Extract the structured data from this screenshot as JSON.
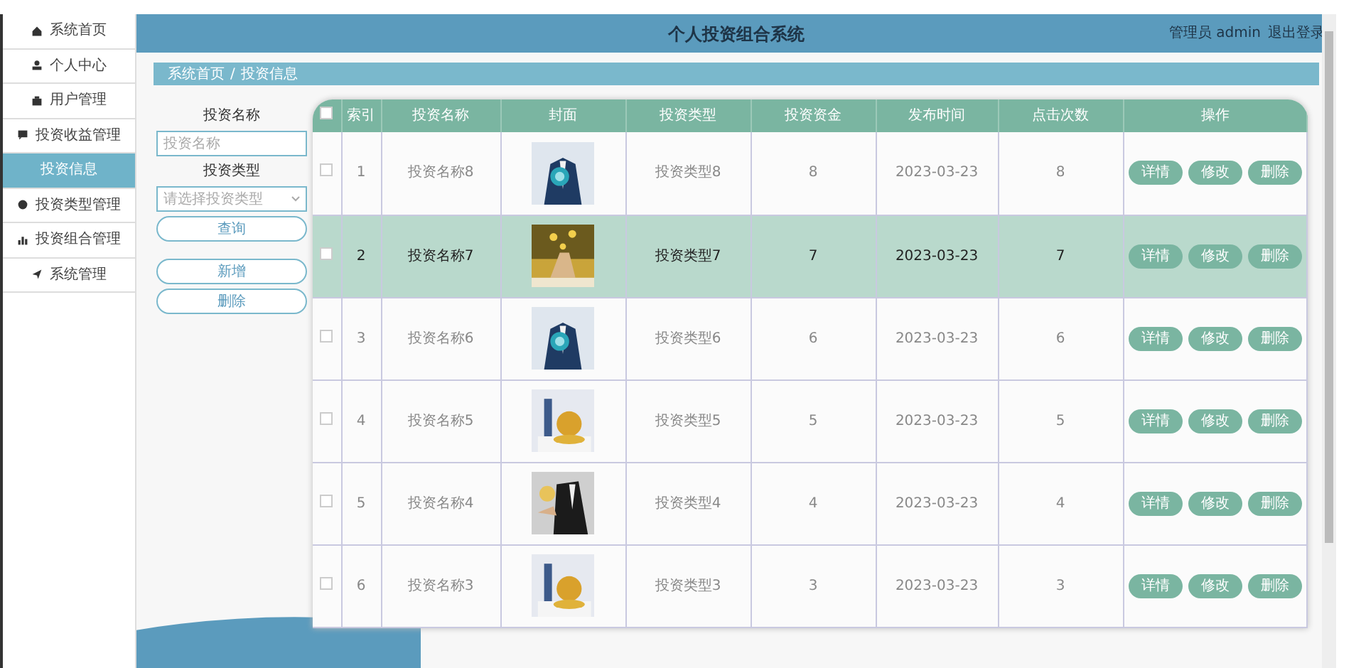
{
  "sidebar": {
    "items": [
      {
        "label": "系统首页",
        "selected": false
      },
      {
        "label": "个人中心",
        "selected": false
      },
      {
        "label": "用户管理",
        "selected": false
      },
      {
        "label": "投资收益管理",
        "selected": false
      },
      {
        "label": "投资信息",
        "selected": true
      },
      {
        "label": "投资类型管理",
        "selected": false
      },
      {
        "label": "投资组合管理",
        "selected": false
      },
      {
        "label": "系统管理",
        "selected": false
      }
    ]
  },
  "header": {
    "title": "个人投资组合系统",
    "user": "管理员 admin",
    "logout": "退出登录"
  },
  "breadcrumb": {
    "home": "系统首页",
    "separator": "/",
    "current": "投资信息"
  },
  "search": {
    "name_label": "投资名称",
    "name_placeholder": "投资名称",
    "type_label": "投资类型",
    "type_placeholder": "请选择投资类型",
    "query": "查询",
    "add": "新增",
    "delete": "删除"
  },
  "table": {
    "columns": [
      "索引",
      "投资名称",
      "封面",
      "投资类型",
      "投资资金",
      "发布时间",
      "点击次数",
      "操作"
    ],
    "rows": [
      {
        "selected": false,
        "checked": false,
        "index": "1",
        "name": "投资名称8",
        "type": "投资类型8",
        "fund": "8",
        "date": "2023-03-23",
        "clicks": "8",
        "actions": [
          "详情",
          "修改",
          "删除"
        ]
      },
      {
        "selected": true,
        "checked": false,
        "index": "2",
        "name": "投资名称7",
        "type": "投资类型7",
        "fund": "7",
        "date": "2023-03-23",
        "clicks": "7",
        "actions": [
          "详情",
          "修改",
          "删除"
        ]
      },
      {
        "selected": false,
        "checked": false,
        "index": "3",
        "name": "投资名称6",
        "type": "投资类型6",
        "fund": "6",
        "date": "2023-03-23",
        "clicks": "6",
        "actions": [
          "详情",
          "修改",
          "删除"
        ]
      },
      {
        "selected": false,
        "checked": false,
        "index": "4",
        "name": "投资名称5",
        "type": "投资类型5",
        "fund": "5",
        "date": "2023-03-23",
        "clicks": "5",
        "actions": [
          "详情",
          "修改",
          "删除"
        ]
      },
      {
        "selected": false,
        "checked": false,
        "index": "5",
        "name": "投资名称4",
        "type": "投资类型4",
        "fund": "4",
        "date": "2023-03-23",
        "clicks": "4",
        "actions": [
          "详情",
          "修改",
          "删除"
        ]
      },
      {
        "selected": false,
        "checked": false,
        "index": "6",
        "name": "投资名称3",
        "type": "投资类型3",
        "fund": "3",
        "date": "2023-03-23",
        "clicks": "3",
        "actions": [
          "详情",
          "修改",
          "删除"
        ]
      }
    ],
    "select_all_checked": false
  }
}
